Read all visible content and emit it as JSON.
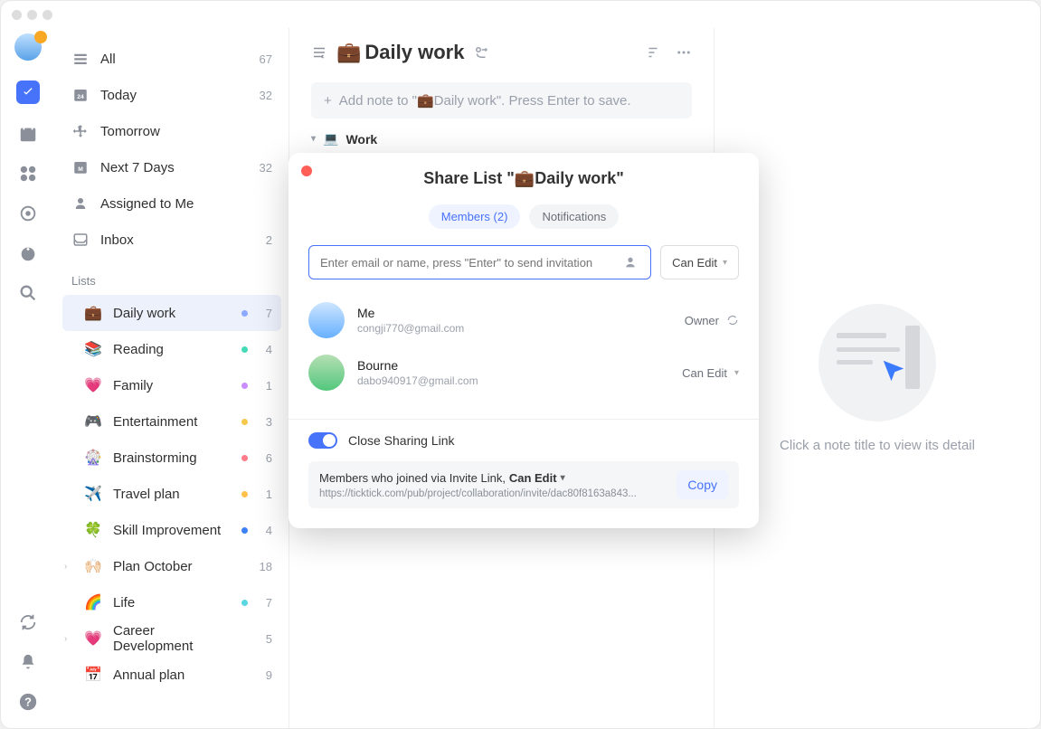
{
  "smart_lists": [
    {
      "label": "All",
      "count": "67"
    },
    {
      "label": "Today",
      "count": "32"
    },
    {
      "label": "Tomorrow",
      "count": ""
    },
    {
      "label": "Next 7 Days",
      "count": "32"
    },
    {
      "label": "Assigned to Me",
      "count": ""
    },
    {
      "label": "Inbox",
      "count": "2"
    }
  ],
  "lists_header": "Lists",
  "lists": [
    {
      "emoji": "💼",
      "label": "Daily work",
      "count": "7",
      "dot": "#8aa9ff",
      "active": true,
      "chev": ""
    },
    {
      "emoji": "📚",
      "label": "Reading",
      "count": "4",
      "dot": "#45d9b8",
      "active": false,
      "chev": ""
    },
    {
      "emoji": "💗",
      "label": "Family",
      "count": "1",
      "dot": "#c98dff",
      "active": false,
      "chev": ""
    },
    {
      "emoji": "🎮",
      "label": "Entertainment",
      "count": "3",
      "dot": "#f3c84c",
      "active": false,
      "chev": ""
    },
    {
      "emoji": "🎡",
      "label": "Brainstorming",
      "count": "6",
      "dot": "#ff7a8a",
      "active": false,
      "chev": ""
    },
    {
      "emoji": "✈️",
      "label": "Travel plan",
      "count": "1",
      "dot": "#ffc04c",
      "active": false,
      "chev": ""
    },
    {
      "emoji": "🍀",
      "label": "Skill Improvement",
      "count": "4",
      "dot": "#3b82f6",
      "active": false,
      "chev": ""
    },
    {
      "emoji": "🙌🏻",
      "label": "Plan October",
      "count": "18",
      "dot": "",
      "active": false,
      "chev": "›"
    },
    {
      "emoji": "🌈",
      "label": "Life",
      "count": "7",
      "dot": "#5ad7e2",
      "active": false,
      "chev": ""
    },
    {
      "emoji": "💗",
      "label": "Career Development",
      "count": "5",
      "dot": "",
      "active": false,
      "chev": "›"
    },
    {
      "emoji": "📅",
      "label": "Annual plan",
      "count": "9",
      "dot": "",
      "active": false,
      "chev": ""
    }
  ],
  "page": {
    "title_emoji": "💼",
    "title": "Daily work",
    "add_placeholder": "Add note to \"💼Daily work\". Press Enter to save.",
    "section_emoji": "💻",
    "section_label": "Work"
  },
  "detail_hint": "Click a note title to view its detail",
  "modal": {
    "title": "Share List \"💼Daily work\"",
    "tab_members": "Members (2)",
    "tab_notifications": "Notifications",
    "input_placeholder": "Enter email or name, press \"Enter\" to send invitation",
    "perm_default": "Can Edit",
    "members": [
      {
        "name": "Me",
        "email": "congji770@gmail.com",
        "role": "Owner",
        "sync": true
      },
      {
        "name": "Bourne",
        "email": "dabo940917@gmail.com",
        "role": "Can Edit",
        "sync": false
      }
    ],
    "toggle_label": "Close Sharing Link",
    "link_desc": "Members who joined via Invite Link,",
    "link_perm": "Can Edit",
    "link_url": "https://ticktick.com/pub/project/collaboration/invite/dac80f8163a843...",
    "copy_label": "Copy"
  }
}
